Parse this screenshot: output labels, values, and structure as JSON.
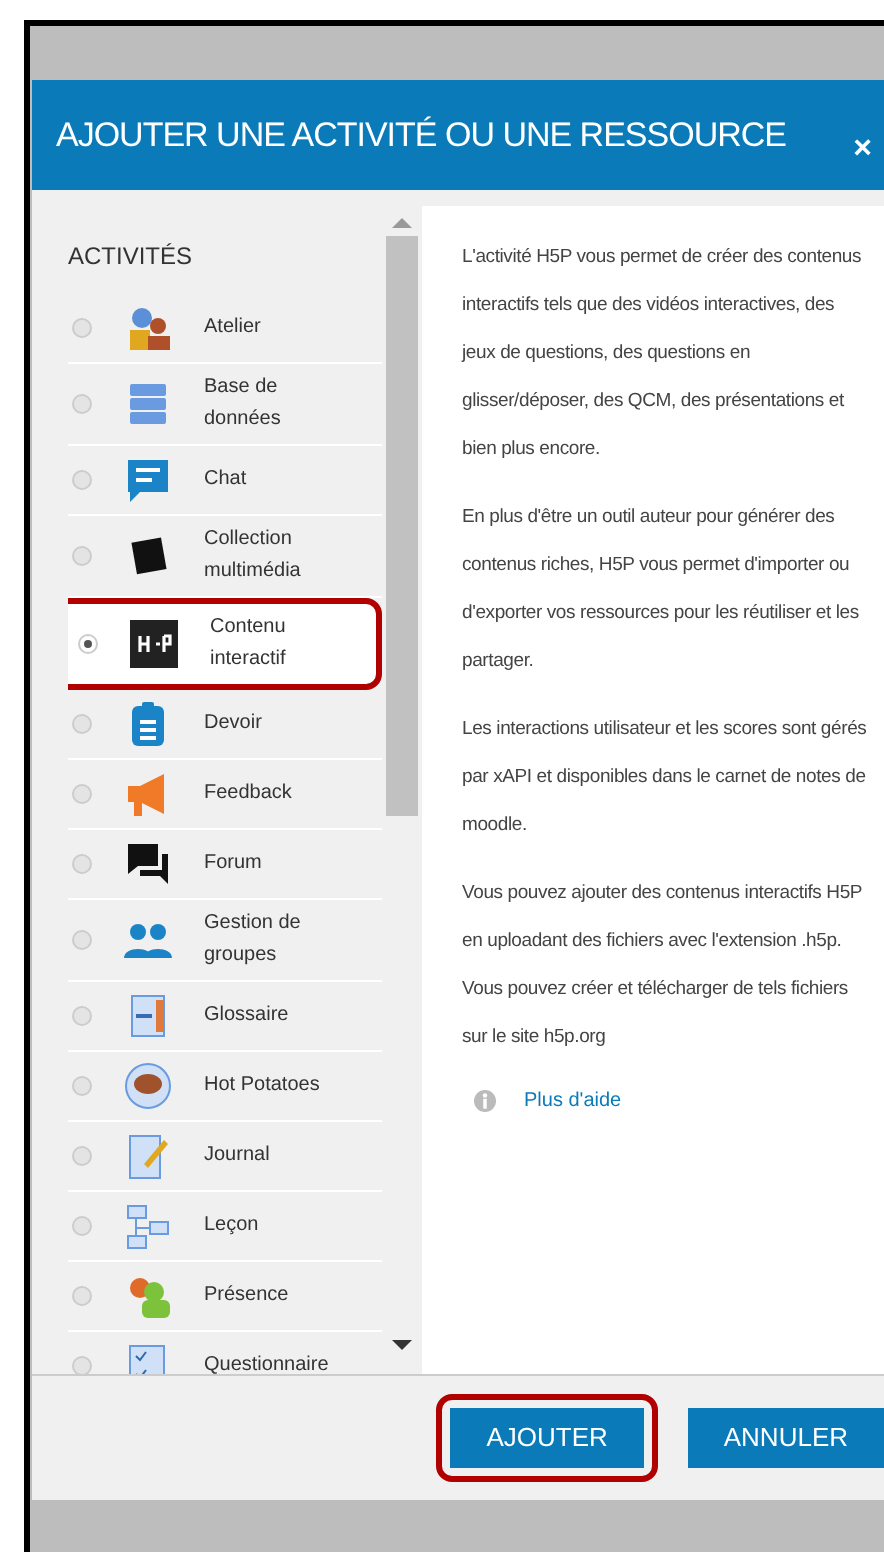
{
  "dialog": {
    "title": "AJOUTER UNE ACTIVITÉ OU UNE RESSOURCE",
    "close": "×"
  },
  "sidebar": {
    "heading": "ACTIVITÉS",
    "items": [
      {
        "label": "Atelier",
        "kind": "people",
        "selected": false,
        "highlighted": false
      },
      {
        "label": "Base de données",
        "kind": "database",
        "selected": false,
        "highlighted": false
      },
      {
        "label": "Chat",
        "kind": "chat",
        "selected": false,
        "highlighted": false
      },
      {
        "label": "Collection multimédia",
        "kind": "media",
        "selected": false,
        "highlighted": false
      },
      {
        "label": "Contenu interactif",
        "kind": "h5p",
        "selected": true,
        "highlighted": true
      },
      {
        "label": "Devoir",
        "kind": "clipboard",
        "selected": false,
        "highlighted": false
      },
      {
        "label": "Feedback",
        "kind": "megaphone",
        "selected": false,
        "highlighted": false
      },
      {
        "label": "Forum",
        "kind": "forum",
        "selected": false,
        "highlighted": false
      },
      {
        "label": "Gestion de groupes",
        "kind": "groups",
        "selected": false,
        "highlighted": false
      },
      {
        "label": "Glossaire",
        "kind": "glossary",
        "selected": false,
        "highlighted": false
      },
      {
        "label": "Hot Potatoes",
        "kind": "potato",
        "selected": false,
        "highlighted": false
      },
      {
        "label": "Journal",
        "kind": "journal",
        "selected": false,
        "highlighted": false
      },
      {
        "label": "Leçon",
        "kind": "lesson",
        "selected": false,
        "highlighted": false
      },
      {
        "label": "Présence",
        "kind": "attendance",
        "selected": false,
        "highlighted": false
      },
      {
        "label": "Questionnaire",
        "kind": "survey",
        "selected": false,
        "highlighted": false
      }
    ]
  },
  "description": {
    "paragraphs": [
      "L'activité H5P vous permet de créer des contenus interactifs tels que des vidéos interactives, des jeux de questions, des questions en glisser/déposer, des QCM, des présentations et bien plus encore.",
      "En plus d'être un outil auteur pour générer des contenus riches, H5P vous permet d'importer ou d'exporter vos ressources pour les réutiliser et les partager.",
      "Les interactions utilisateur et les scores sont gérés par xAPI et disponibles dans le carnet de notes de moodle.",
      "Vous pouvez ajouter des contenus interactifs H5P en uploadant des fichiers avec l'extension .h5p. Vous pouvez créer et télécharger de tels fichiers sur le site h5p.org"
    ],
    "help_link": "Plus d'aide"
  },
  "buttons": [
    {
      "label": "AJOUTER",
      "highlighted": true
    },
    {
      "label": "ANNULER",
      "highlighted": false
    }
  ]
}
